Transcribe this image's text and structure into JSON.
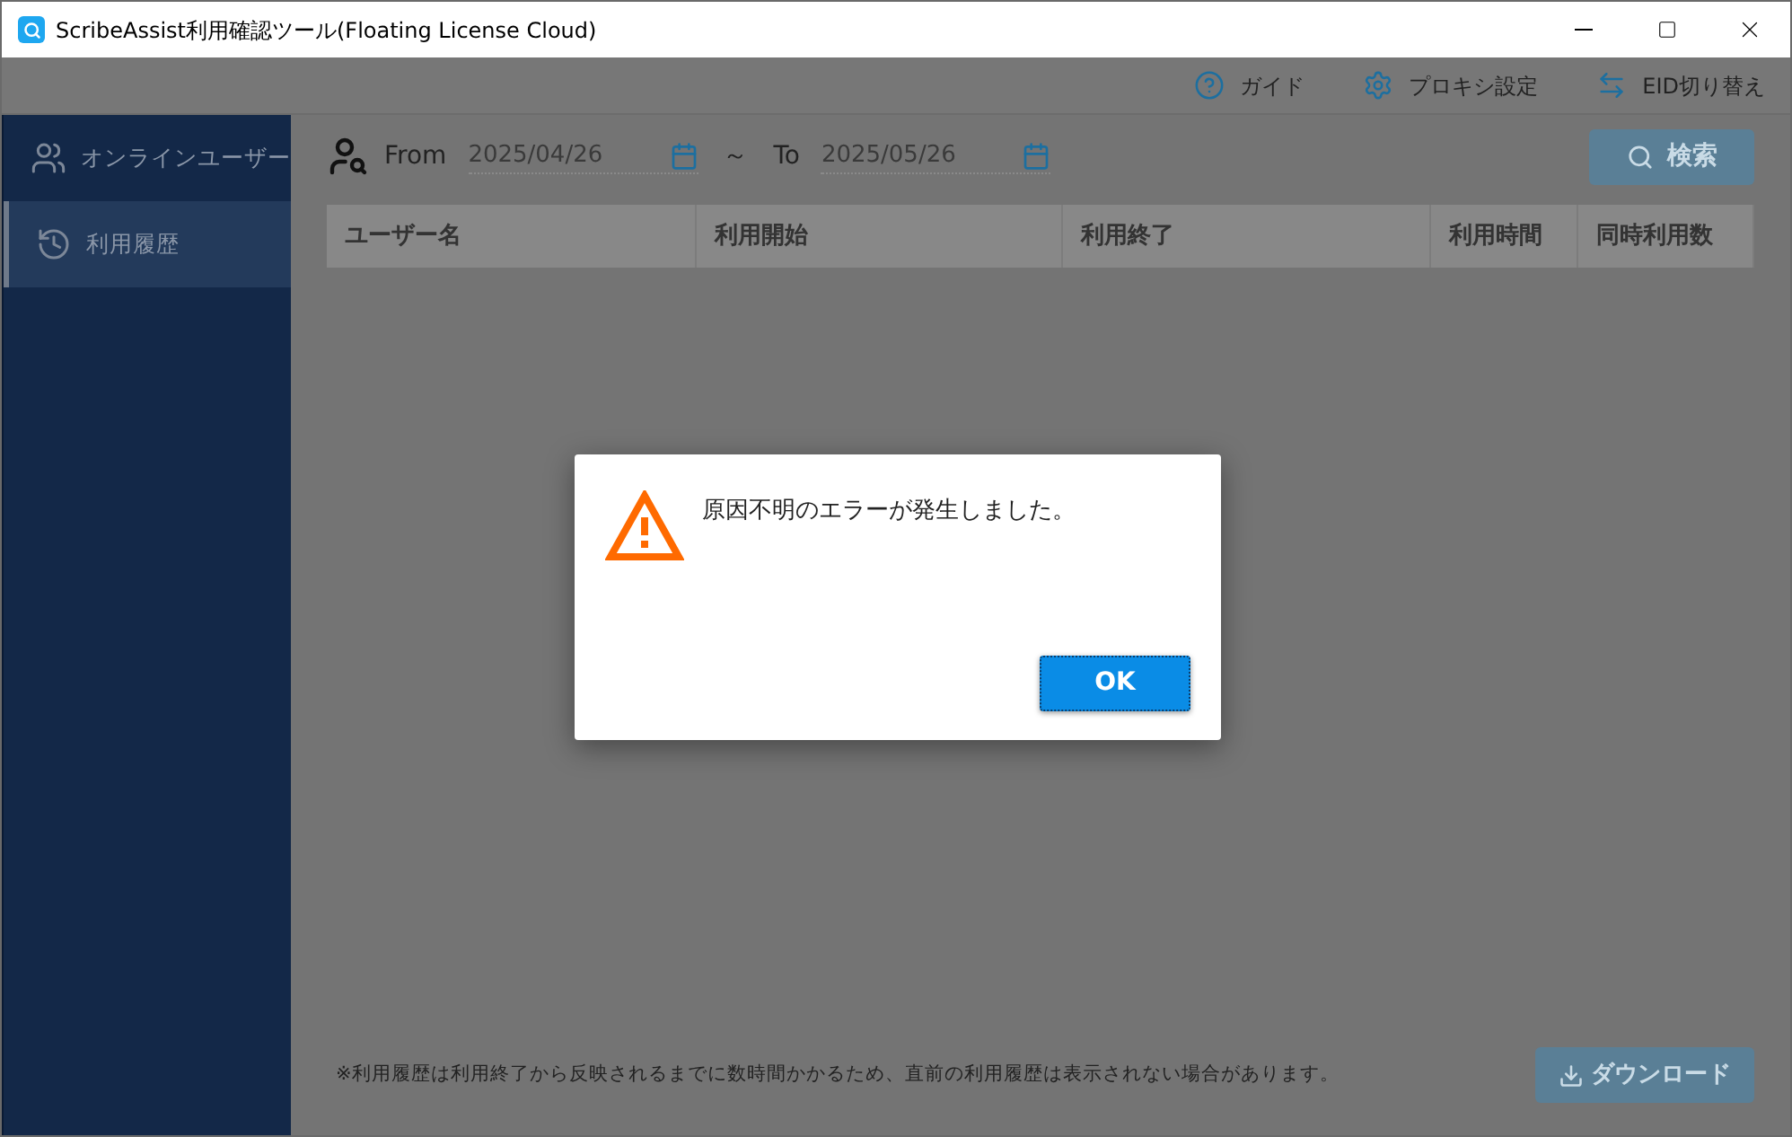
{
  "window": {
    "title": "ScribeAssist利用確認ツール(Floating License Cloud)"
  },
  "toolbar": [
    {
      "kind": "help",
      "label": "ガイド"
    },
    {
      "kind": "settings",
      "label": "プロキシ設定"
    },
    {
      "kind": "switch",
      "label": "EID切り替え"
    }
  ],
  "sidebar": {
    "items": [
      {
        "kind": "users",
        "label": "オンラインユーザー",
        "selected": false
      },
      {
        "kind": "history",
        "label": "利用履歴",
        "selected": true
      }
    ]
  },
  "filter": {
    "from_label": "From",
    "from_value": "2025/04/26",
    "separator": "～",
    "to_label": "To",
    "to_value": "2025/05/26",
    "search_button": {
      "label": "検索",
      "disabled": true
    }
  },
  "table": {
    "columns": [
      "ユーザー名",
      "利用開始",
      "利用終了",
      "利用時間",
      "同時利用数"
    ]
  },
  "footer": {
    "note": "※利用履歴は利用終了から反映されるまでに数時間かかるため、直前の利用履歴は表示されない場合があります。",
    "download_button": {
      "label": "ダウンロード",
      "disabled": true
    }
  },
  "dialog": {
    "message": "原因不明のエラーが発生しました。",
    "button": "OK"
  }
}
